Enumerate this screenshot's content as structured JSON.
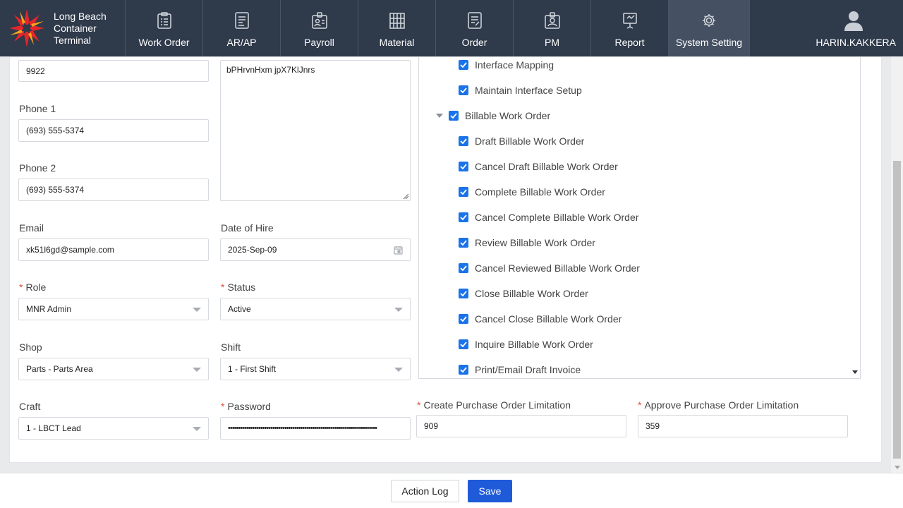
{
  "header": {
    "brand_lines": [
      "Long Beach",
      "Container",
      "Terminal"
    ],
    "nav": [
      {
        "label": "Work Order",
        "icon": "clipboard-list-icon"
      },
      {
        "label": "AR/AP",
        "icon": "document-lines-icon"
      },
      {
        "label": "Payroll",
        "icon": "id-badge-icon"
      },
      {
        "label": "Material",
        "icon": "shelving-icon"
      },
      {
        "label": "Order",
        "icon": "document-edit-icon"
      },
      {
        "label": "PM",
        "icon": "id-card-icon"
      },
      {
        "label": "Report",
        "icon": "presentation-icon"
      },
      {
        "label": "System Setting",
        "icon": "gear-icon",
        "active": true
      }
    ],
    "user_name": "HARIN.KAKKERA"
  },
  "form": {
    "top_field_value": "9922",
    "phone1_label": "Phone 1",
    "phone1_value": "(693) 555-5374",
    "phone2_label": "Phone 2",
    "phone2_value": "(693) 555-5374",
    "notes_value": "bPHrvnHxm jpX7KlJnrs",
    "email_label": "Email",
    "email_value": "xk51l6gd@sample.com",
    "hire_label": "Date of Hire",
    "hire_value": "2025-Sep-09",
    "role_label": "Role",
    "role_value": "MNR Admin",
    "status_label": "Status",
    "status_value": "Active",
    "shop_label": "Shop",
    "shop_value": "Parts - Parts Area",
    "shift_label": "Shift",
    "shift_value": "1 - First Shift",
    "craft_label": "Craft",
    "craft_value": "1 - LBCT Lead",
    "password_label": "Password",
    "password_value": "••••••••••••••••••••••••••••••••••••••••••••••••••••••••••••••••••••••••••",
    "create_po_label": "Create Purchase Order Limitation",
    "create_po_value": "909",
    "approve_po_label": "Approve Purchase Order Limitation",
    "approve_po_value": "359"
  },
  "permissions": {
    "rows": [
      {
        "label": "Interface Mapping",
        "level": 2,
        "checked": true
      },
      {
        "label": "Maintain Interface Setup",
        "level": 2,
        "checked": true
      },
      {
        "label": "Billable Work Order",
        "level": 1,
        "checked": true,
        "expanded": true
      },
      {
        "label": "Draft Billable Work Order",
        "level": 2,
        "checked": true
      },
      {
        "label": "Cancel Draft Billable Work Order",
        "level": 2,
        "checked": true
      },
      {
        "label": "Complete Billable Work Order",
        "level": 2,
        "checked": true
      },
      {
        "label": "Cancel Complete Billable Work Order",
        "level": 2,
        "checked": true
      },
      {
        "label": "Review Billable Work Order",
        "level": 2,
        "checked": true
      },
      {
        "label": "Cancel Reviewed Billable Work Order",
        "level": 2,
        "checked": true
      },
      {
        "label": "Close Billable Work Order",
        "level": 2,
        "checked": true
      },
      {
        "label": "Cancel Close Billable Work Order",
        "level": 2,
        "checked": true
      },
      {
        "label": "Inquire Billable Work Order",
        "level": 2,
        "checked": true
      },
      {
        "label": "Print/Email Draft Invoice",
        "level": 2,
        "checked": true
      }
    ]
  },
  "footer": {
    "action_log_label": "Action Log",
    "save_label": "Save"
  },
  "colors": {
    "header_bg": "#2f3a4b",
    "accent": "#1f5bd8",
    "checkbox": "#1a73e8",
    "required": "#e0523f"
  }
}
